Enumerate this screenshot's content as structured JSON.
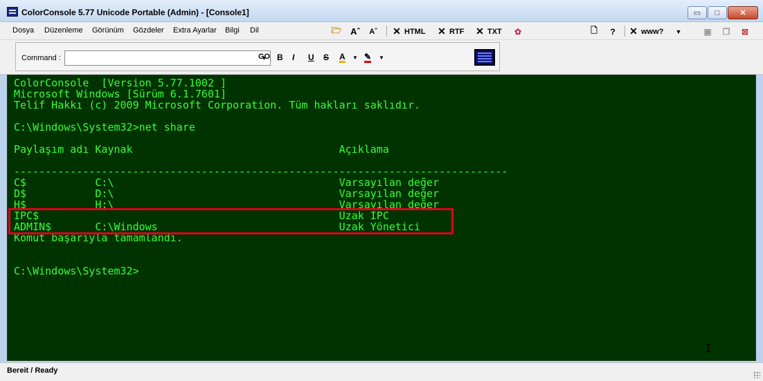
{
  "window": {
    "title": "ColorConsole 5.77 Unicode Portable (Admin) - [Console1]",
    "controls": {
      "minimize": "▭",
      "maximize": "□",
      "close": "✕"
    }
  },
  "menu": {
    "items": [
      "Dosya",
      "Düzenleme",
      "Görünüm",
      "Gözdeler",
      "Extra Ayarlar",
      "Bilgi",
      "Dil"
    ]
  },
  "toolbar": {
    "html_label": "HTML",
    "rtf_label": "RTF",
    "txt_label": "TXT",
    "www_label": "www?",
    "help_label": "?",
    "icons": [
      "open-folder-icon",
      "font-increase-icon",
      "font-decrease-icon",
      "export-html-icon",
      "export-rtf-icon",
      "export-txt-icon",
      "palette-icon",
      "new-document-icon",
      "help-icon",
      "web-icon",
      "dropdown-icon",
      "close-tab-icon",
      "duplicate-tab-icon",
      "remove-tab-icon"
    ]
  },
  "command": {
    "label": "Command :",
    "value": "",
    "format_labels": {
      "go": "GO",
      "bold": "B",
      "italic": "I",
      "underline": "U",
      "strike": "S",
      "font_color": "A"
    },
    "font_color": "#f0b000",
    "highlight_color": "#e00000"
  },
  "console": {
    "background": "#003300",
    "foreground": "#37ff37",
    "lines": [
      "ColorConsole  [Version 5.77.1002 ]",
      "Microsoft Windows [Sürüm 6.1.7601]",
      "Telif Hakkı (c) 2009 Microsoft Corporation. Tüm hakları saklıdır.",
      "",
      "C:\\Windows\\System32>net share",
      "",
      "Paylaşım adı Kaynak                                 Açıklama",
      "",
      "-------------------------------------------------------------------------------",
      "C$           C:\\                                    Varsayılan değer",
      "D$           D:\\                                    Varsayılan değer",
      "H$           H:\\                                    Varsayılan değer",
      "IPC$                                                Uzak IPC",
      "ADMIN$       C:\\Windows                             Uzak Yönetici",
      "Komut başarıyla tamamlandı.",
      "",
      "",
      "C:\\Windows\\System32>"
    ],
    "highlight_color": "#e0001a"
  },
  "status": {
    "text": "Bereit / Ready"
  }
}
